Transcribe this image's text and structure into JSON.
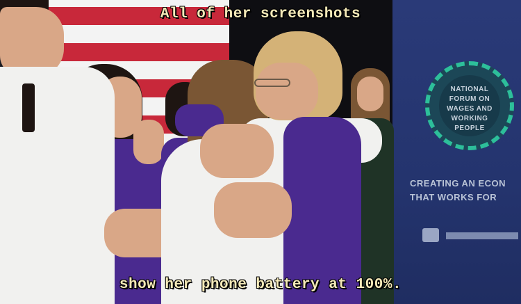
{
  "caption": {
    "top": "All of her screenshots",
    "bottom": "show her phone battery at 100%."
  },
  "banner": {
    "badge_lines": [
      "NATIONAL",
      "FORUM ON",
      "WAGES AND",
      "WORKING",
      "PEOPLE"
    ],
    "line1": "CREATING AN ECON",
    "line2": "THAT WORKS FOR"
  },
  "colors": {
    "caption": "#f4e9b8",
    "banner": "#2a3a78",
    "badge_ring": "#2dbf9a",
    "shirt_purple": "#4a2a8f"
  }
}
